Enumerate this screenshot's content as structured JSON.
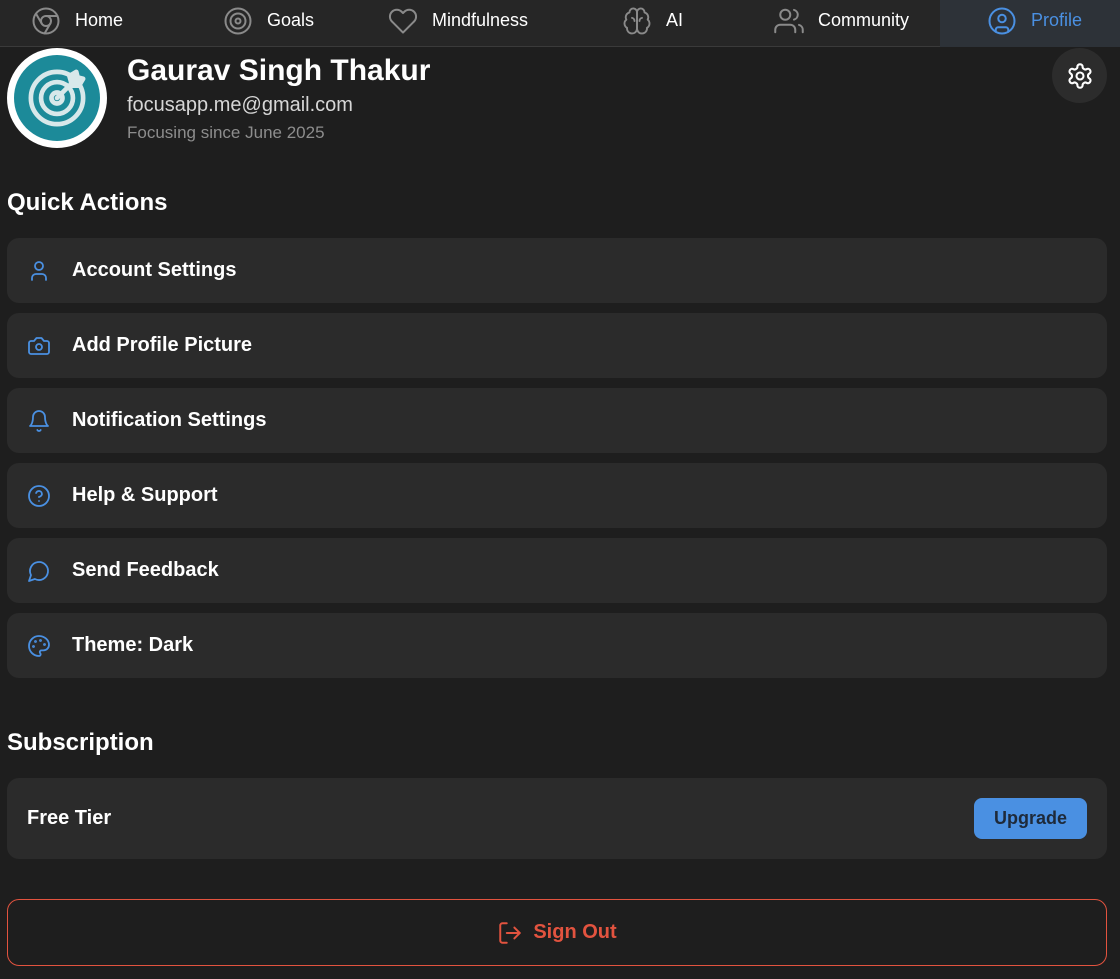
{
  "nav": {
    "items": [
      {
        "label": "Home",
        "icon": "chrome-icon"
      },
      {
        "label": "Goals",
        "icon": "target-icon"
      },
      {
        "label": "Mindfulness",
        "icon": "heart-icon"
      },
      {
        "label": "AI",
        "icon": "brain-icon"
      },
      {
        "label": "Community",
        "icon": "users-icon"
      },
      {
        "label": "Profile",
        "icon": "user-circle-icon"
      }
    ],
    "active": "Profile",
    "accent_color": "#4a90e2"
  },
  "profile": {
    "name": "Gaurav Singh Thakur",
    "email": "focusapp.me@gmail.com",
    "since": "Focusing since June 2025",
    "avatar_color": "#1c8a99"
  },
  "quick_actions": {
    "title": "Quick Actions",
    "items": [
      {
        "label": "Account Settings",
        "icon": "user-icon"
      },
      {
        "label": "Add Profile Picture",
        "icon": "camera-icon"
      },
      {
        "label": "Notification Settings",
        "icon": "bell-icon"
      },
      {
        "label": "Help & Support",
        "icon": "help-circle-icon"
      },
      {
        "label": "Send Feedback",
        "icon": "message-circle-icon"
      },
      {
        "label": "Theme: Dark",
        "icon": "palette-icon"
      }
    ]
  },
  "subscription": {
    "title": "Subscription",
    "tier": "Free Tier",
    "upgrade_label": "Upgrade"
  },
  "sign_out": {
    "label": "Sign Out",
    "color": "#e2533f"
  }
}
